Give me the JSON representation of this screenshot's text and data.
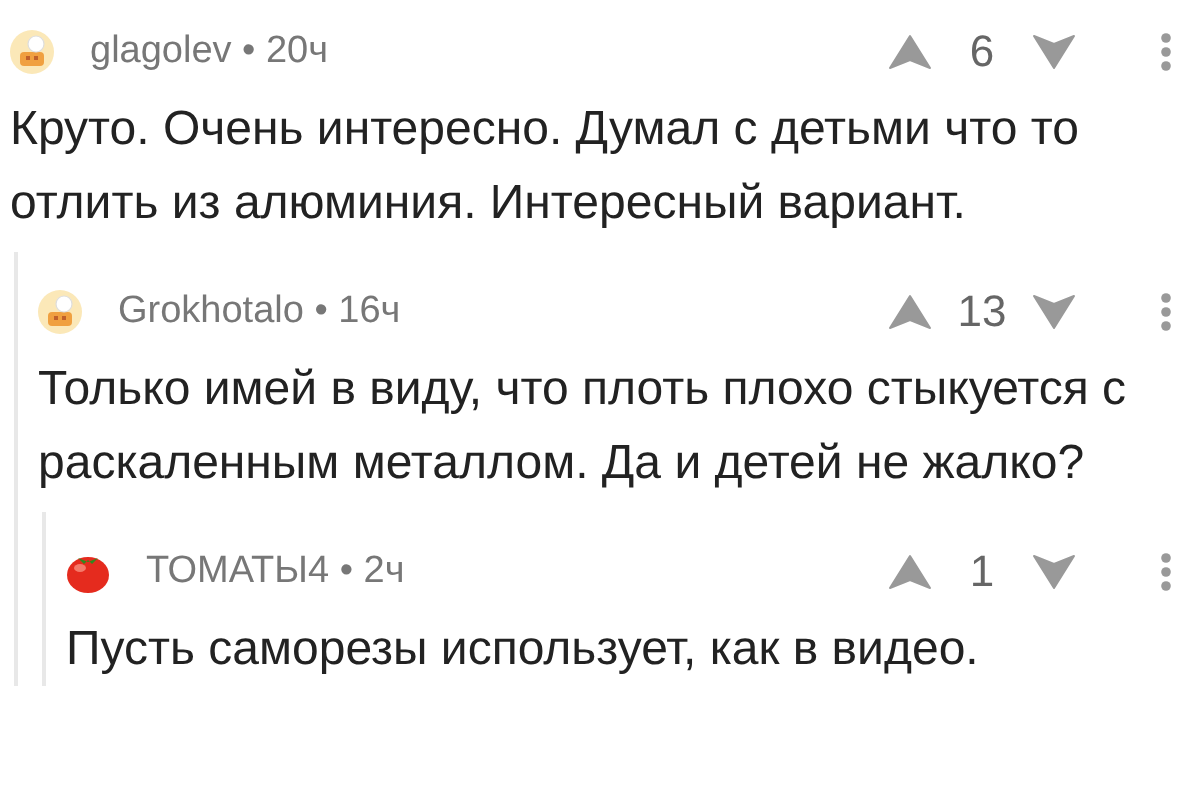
{
  "comments": [
    {
      "kind": "chef",
      "byline": "glagolev • 20ч",
      "votes": "6",
      "text": "Круто. Очень интересно. Думал с детьми что то отлить из алюминия. Интересный вариант.",
      "children": [
        {
          "kind": "chef",
          "byline": "Grokhotalo • 16ч",
          "votes": "13",
          "text": "Только имей в виду, что плоть плохо стыкуется с раскаленным металлом. Да и детей не жалко?",
          "children": [
            {
              "kind": "tomato",
              "byline": "ТОМАТЫ4 • 2ч",
              "votes": "1",
              "text": "Пусть саморезы использует, как в видео."
            }
          ]
        }
      ]
    }
  ]
}
